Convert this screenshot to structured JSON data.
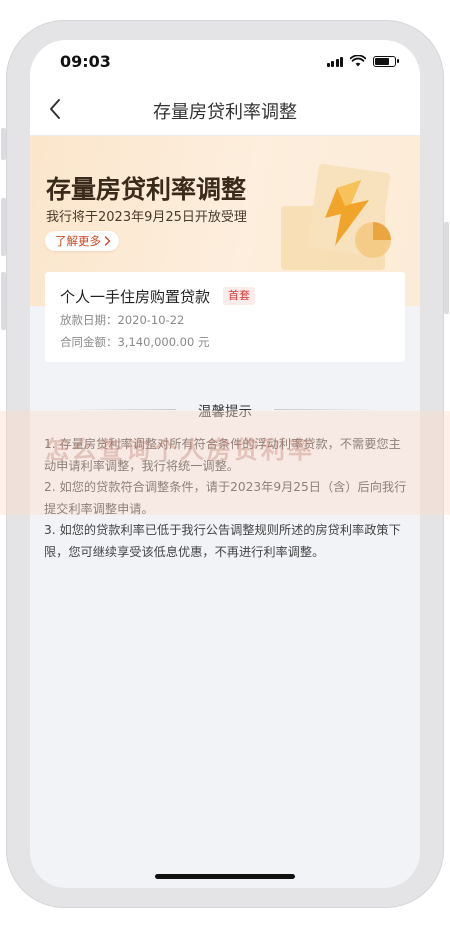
{
  "status_bar": {
    "time": "09:03"
  },
  "nav": {
    "title": "存量房贷利率调整"
  },
  "banner": {
    "title": "存量房贷利率调整",
    "subtitle": "我行将于2023年9月25日开放受理",
    "learn_more_label": "了解更多"
  },
  "loan": {
    "name": "个人一手住房购置贷款",
    "badge": "首套",
    "date_label": "放款日期：",
    "date_value": "2020-10-22",
    "amount_label": "合同金额：",
    "amount_value": "3,140,000.00 元"
  },
  "tips": {
    "title": "温馨提示",
    "items": [
      "1. 存量房贷利率调整对所有符合条件的浮动利率贷款，不需要您主动申请利率调整，我行将统一调整。",
      "2. 如您的贷款符合调整条件，请于2023年9月25日（含）后向我行提交利率调整申请。",
      "3. 如您的贷款利率已低于我行公告调整规则所述的房贷利率政策下限，您可继续享受该低息优惠，不再进行利率调整。"
    ]
  },
  "watermark": {
    "text": "怎么查询个人房贷利率"
  },
  "colors": {
    "accent": "#c84b23",
    "badge_text": "#d9383a",
    "banner_bg": "#fbe6cc"
  },
  "icons": {
    "back": "chevron-left-icon",
    "wifi": "wifi-icon",
    "battery": "battery-icon",
    "signal": "signal-icon"
  }
}
